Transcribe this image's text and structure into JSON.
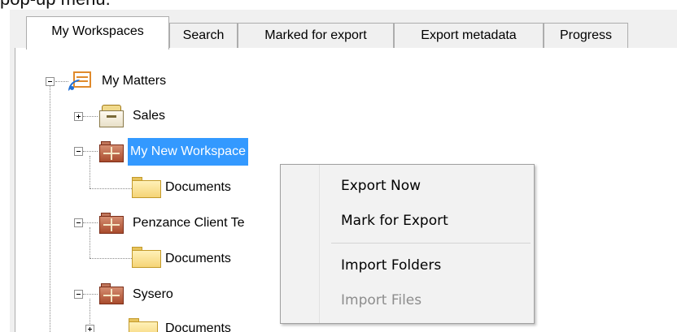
{
  "caption_fragment": "pop-up menu.",
  "tabs": [
    {
      "label": "My Workspaces",
      "active": true
    },
    {
      "label": "Search",
      "active": false
    },
    {
      "label": "Marked for export",
      "active": false
    },
    {
      "label": "Export metadata",
      "active": false
    },
    {
      "label": "Progress",
      "active": false
    }
  ],
  "tree": {
    "root": {
      "label": "My Matters",
      "icon": "matters-feed-icon",
      "expanded": true
    },
    "nodes": [
      {
        "label": "Sales",
        "icon": "filing-cabinet-icon",
        "expanded": false
      },
      {
        "label": "My New Workspace",
        "icon": "workspace-icon",
        "expanded": true,
        "selected": true
      },
      {
        "label": "Documents",
        "icon": "folder-icon"
      },
      {
        "label": "Penzance Client Te",
        "icon": "workspace-icon",
        "expanded": true
      },
      {
        "label": "Documents",
        "icon": "folder-icon"
      },
      {
        "label": "Sysero",
        "icon": "workspace-icon",
        "expanded": true
      },
      {
        "label": "Documents",
        "icon": "folder-icon",
        "expanded": false
      }
    ]
  },
  "context_menu": {
    "items": [
      {
        "label": "Export Now",
        "enabled": true
      },
      {
        "label": "Mark for Export",
        "enabled": true
      },
      {
        "label": "Import Folders",
        "enabled": true
      },
      {
        "label": "Import Files",
        "enabled": false
      }
    ]
  },
  "colors": {
    "selection": "#3399ff",
    "menu_background": "#f2f2f2",
    "disabled_text": "#8d8d8d"
  }
}
